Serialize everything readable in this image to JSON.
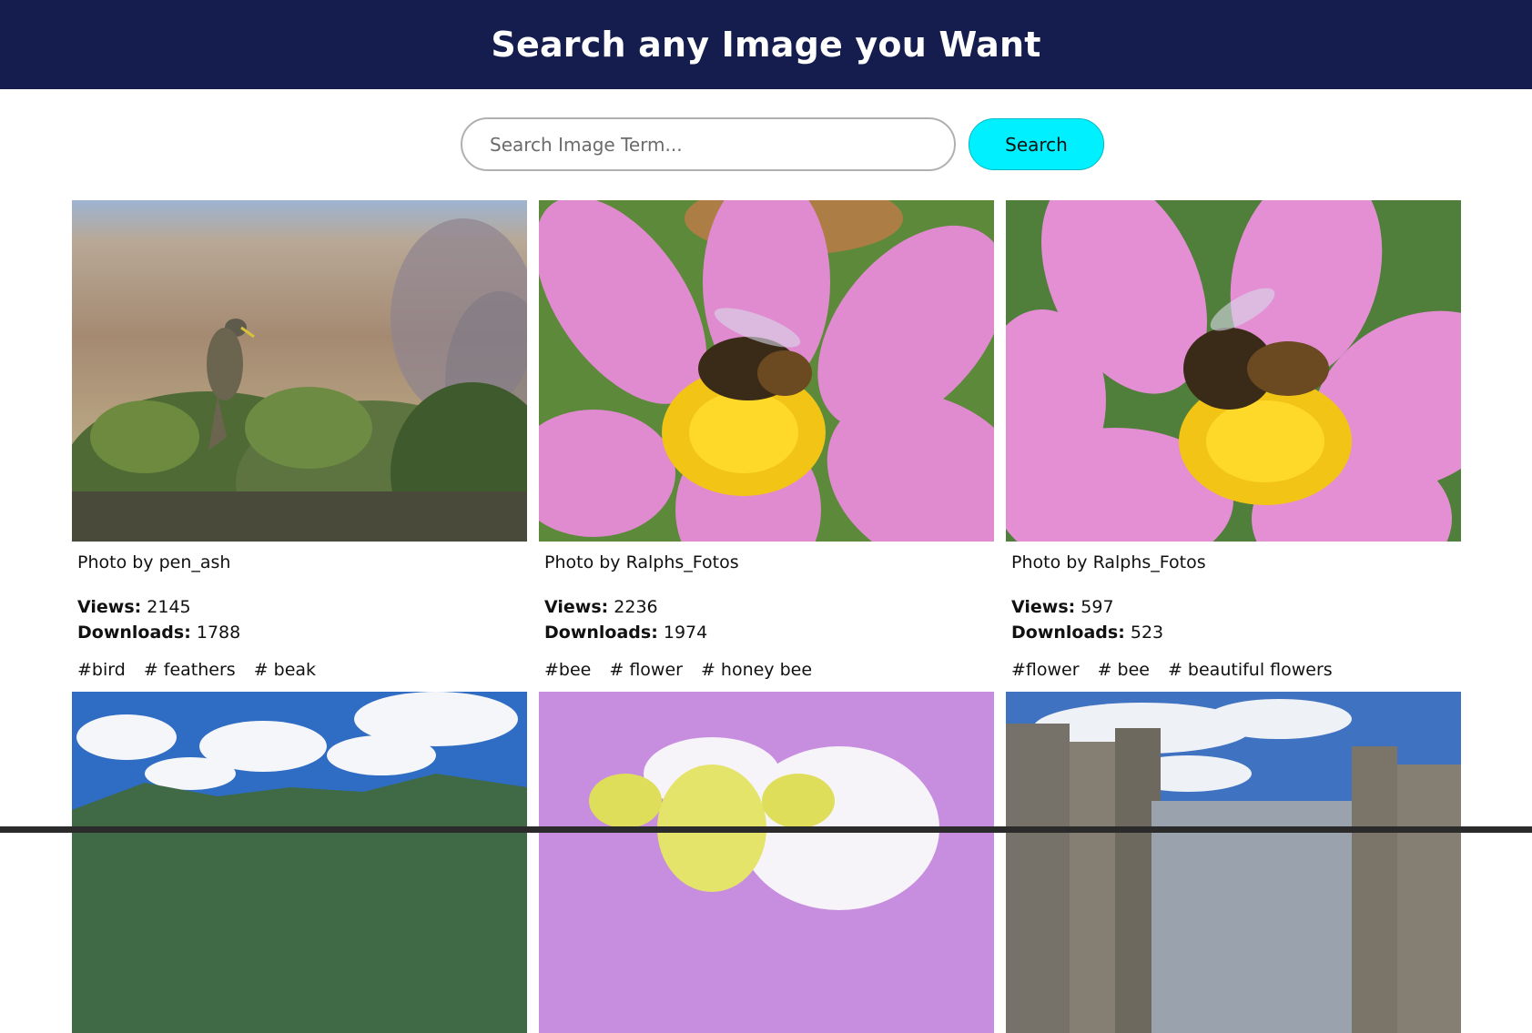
{
  "header": {
    "title": "Search any Image you Want"
  },
  "search": {
    "placeholder": "Search Image Term...",
    "value": "",
    "button_label": "Search"
  },
  "labels": {
    "views": "Views:",
    "downloads": "Downloads:"
  },
  "cards": [
    {
      "author": "Photo by pen_ash",
      "views": "2145",
      "downloads": "1788",
      "tags": [
        "#bird",
        "# feathers",
        "# beak"
      ],
      "image": "bird-on-shrub"
    },
    {
      "author": "Photo by Ralphs_Fotos",
      "views": "2236",
      "downloads": "1974",
      "tags": [
        "#bee",
        "# flower",
        "# honey bee"
      ],
      "image": "bee-on-pink-flower"
    },
    {
      "author": "Photo by Ralphs_Fotos",
      "views": "597",
      "downloads": "523",
      "tags": [
        "#flower",
        "# bee",
        "# beautiful flowers"
      ],
      "image": "bee-on-pink-flower-closeup"
    },
    {
      "image": "mountains-and-clouds"
    },
    {
      "image": "cartoon-sheep"
    },
    {
      "image": "castle-towers"
    }
  ],
  "colors": {
    "header_bg": "#141d4e",
    "search_button_bg": "#00f0ff"
  }
}
